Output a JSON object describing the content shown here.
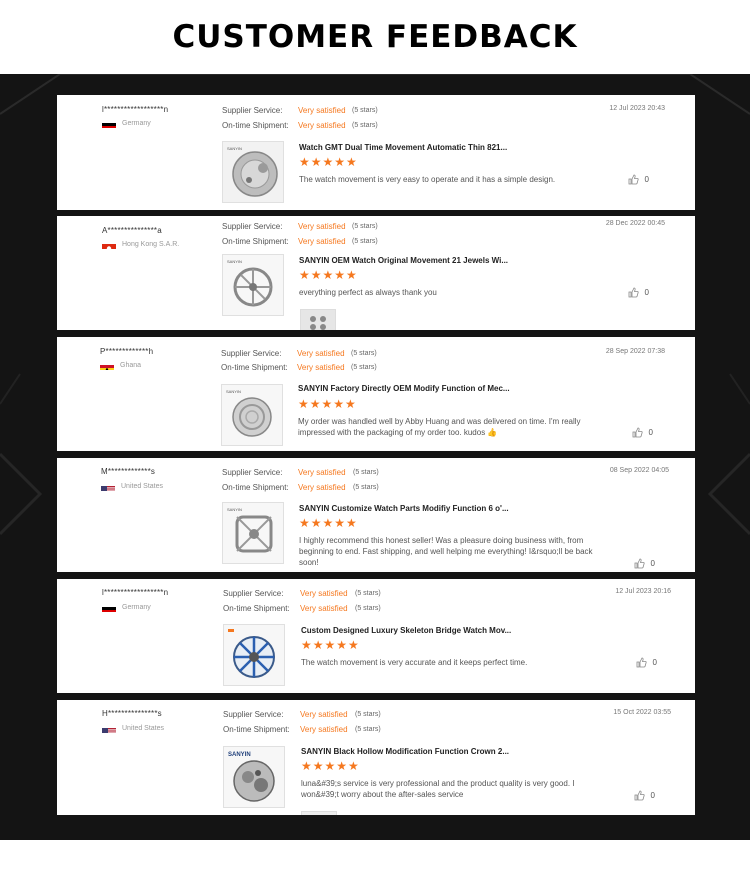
{
  "header": {
    "title": "CUSTOMER FEEDBACK"
  },
  "labels": {
    "supplier_service": "Supplier Service:",
    "on_time_shipment": "On-time Shipment:"
  },
  "colors": {
    "accent": "#f5781f",
    "background": "#141414"
  },
  "reviews": [
    {
      "user": "l******************n",
      "country": "Germany",
      "flag": "germany",
      "date": "12 Jul 2023 20:43",
      "supplier_value": "Very satisfied",
      "supplier_stars": "(5 stars)",
      "shipment_value": "Very satisfied",
      "shipment_stars": "(5 stars)",
      "product_title": "Watch GMT Dual Time Movement Automatic Thin 821...",
      "rating": "★★★★★",
      "comment": "The watch movement is very easy to operate and it has a simple design.",
      "likes": "0"
    },
    {
      "user": "A***************a",
      "country": "Hong Kong S.A.R.",
      "flag": "hongkong",
      "date": "28 Dec 2022 00:45",
      "supplier_value": "Very satisfied",
      "supplier_stars": "(5 stars)",
      "shipment_value": "Very satisfied",
      "shipment_stars": "(5 stars)",
      "product_title": "SANYIN OEM Watch Original Movement 21 Jewels Wi...",
      "rating": "★★★★★",
      "comment": "everything perfect as always thank you",
      "likes": "0"
    },
    {
      "user": "P*************h",
      "country": "Ghana",
      "flag": "ghana",
      "date": "28 Sep 2022 07:38",
      "supplier_value": "Very satisfied",
      "supplier_stars": "(5 stars)",
      "shipment_value": "Very satisfied",
      "shipment_stars": "(5 stars)",
      "product_title": "SANYIN Factory Directly OEM Modify Function of Mec...",
      "rating": "★★★★★",
      "comment": "My order was handled well by Abby Huang and was delivered on time. I'm really impressed with  the packaging of my order too. kudos 👍",
      "likes": "0"
    },
    {
      "user": "M*************s",
      "country": "United States",
      "flag": "us",
      "date": "08 Sep 2022 04:05",
      "supplier_value": "Very satisfied",
      "supplier_stars": "(5 stars)",
      "shipment_value": "Very satisfied",
      "shipment_stars": "(5 stars)",
      "product_title": "SANYIN Customize Watch Parts Modifiy Function 6 o'...",
      "rating": "★★★★★",
      "comment": "I highly recommend this honest seller! Was a pleasure doing business with, from beginning to end. Fast shipping, and well helping me everything! I&rsquo;ll be back soon!",
      "likes": "0"
    },
    {
      "user": "l******************n",
      "country": "Germany",
      "flag": "germany",
      "date": "12 Jul 2023 20:16",
      "supplier_value": "Very satisfied",
      "supplier_stars": "(5 stars)",
      "shipment_value": "Very satisfied",
      "shipment_stars": "(5 stars)",
      "product_title": "Custom Designed Luxury Skeleton Bridge Watch Mov...",
      "rating": "★★★★★",
      "comment": "The watch movement is very accurate and it keeps perfect time.",
      "likes": "0"
    },
    {
      "user": "H***************s",
      "country": "United States",
      "flag": "us",
      "date": "15 Oct 2022 03:55",
      "supplier_value": "Very satisfied",
      "supplier_stars": "(5 stars)",
      "shipment_value": "Very satisfied",
      "shipment_stars": "(5 stars)",
      "product_title": "SANYIN Black Hollow Modification Function Crown 2...",
      "rating": "★★★★★",
      "comment": "luna&#39;s service is very professional and the product quality is very good. I won&#39;t worry about the after-sales service",
      "likes": "0"
    }
  ],
  "thumb_brand": "SANYIN"
}
